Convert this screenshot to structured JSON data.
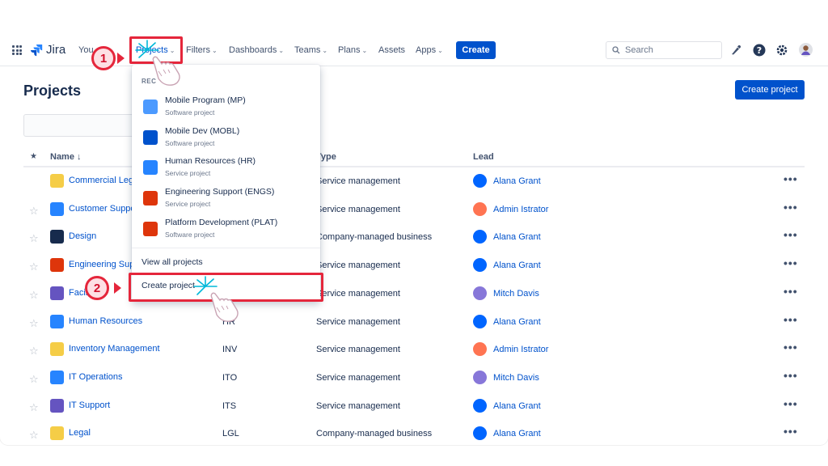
{
  "nav": {
    "logo": "Jira",
    "items": [
      {
        "label": "Your work",
        "visible": "You",
        "active": false
      },
      {
        "label": "Projects",
        "active": true
      },
      {
        "label": "Filters"
      },
      {
        "label": "Dashboards"
      },
      {
        "label": "Teams"
      },
      {
        "label": "Plans"
      },
      {
        "label": "Assets"
      },
      {
        "label": "Apps"
      }
    ],
    "create_label": "Create",
    "search_placeholder": "Search"
  },
  "page": {
    "title": "Projects",
    "create_project_label": "Create project"
  },
  "table": {
    "headers": {
      "name": "Name ↓",
      "type": "Type",
      "lead": "Lead"
    },
    "rows": [
      {
        "name": "Commercial Legal",
        "visible_name": "Commercial Lega",
        "key": "",
        "type": "Service management",
        "lead": "Alana Grant",
        "icon_color": "#f5cd47",
        "avatar_color": "#0065ff",
        "starred": true
      },
      {
        "name": "Customer Support",
        "visible_name": "Customer Suppo",
        "key": "",
        "type": "Service management",
        "lead": "Admin Istrator",
        "icon_color": "#2684ff",
        "avatar_color": "#ff7452",
        "starred": false
      },
      {
        "name": "Design",
        "visible_name": "Design",
        "key": "",
        "type": "Company-managed business",
        "lead": "Alana Grant",
        "icon_color": "#172b4d",
        "avatar_color": "#0065ff",
        "starred": false
      },
      {
        "name": "Engineering Support",
        "visible_name": "Engineering Supp",
        "key": "",
        "type": "Service management",
        "lead": "Alana Grant",
        "icon_color": "#de350b",
        "avatar_color": "#0065ff",
        "starred": false
      },
      {
        "name": "Facilities",
        "visible_name": "Facil",
        "key": "",
        "type": "Service management",
        "lead": "Mitch Davis",
        "icon_color": "#6554c0",
        "avatar_color": "#8777d9",
        "starred": false
      },
      {
        "name": "Human Resources",
        "visible_name": "Human Resources",
        "key": "HR",
        "type": "Service management",
        "lead": "Alana Grant",
        "icon_color": "#2684ff",
        "avatar_color": "#0065ff",
        "starred": false
      },
      {
        "name": "Inventory Management",
        "visible_name": "Inventory Management",
        "key": "INV",
        "type": "Service management",
        "lead": "Admin Istrator",
        "icon_color": "#f5cd47",
        "avatar_color": "#ff7452",
        "starred": false
      },
      {
        "name": "IT Operations",
        "visible_name": "IT Operations",
        "key": "ITO",
        "type": "Service management",
        "lead": "Mitch Davis",
        "icon_color": "#2684ff",
        "avatar_color": "#8777d9",
        "starred": false
      },
      {
        "name": "IT Support",
        "visible_name": "IT Support",
        "key": "ITS",
        "type": "Service management",
        "lead": "Alana Grant",
        "icon_color": "#6554c0",
        "avatar_color": "#0065ff",
        "starred": false
      },
      {
        "name": "Legal",
        "visible_name": "Legal",
        "key": "LGL",
        "type": "Company-managed business",
        "lead": "Alana Grant",
        "icon_color": "#f5cd47",
        "avatar_color": "#0065ff",
        "starred": false
      }
    ]
  },
  "dropdown": {
    "section_label": "RECENT",
    "section_visible": "REC",
    "items": [
      {
        "title": "Mobile Program (MP)",
        "subtitle": "Software project",
        "icon_color": "#4c9aff"
      },
      {
        "title": "Mobile Dev (MOBL)",
        "subtitle": "Software project",
        "icon_color": "#0052cc"
      },
      {
        "title": "Human Resources (HR)",
        "subtitle": "Service project",
        "icon_color": "#2684ff"
      },
      {
        "title": "Engineering Support (ENGS)",
        "subtitle": "Service project",
        "icon_color": "#de350b"
      },
      {
        "title": "Platform Development (PLAT)",
        "subtitle": "Software project",
        "icon_color": "#de350b"
      }
    ],
    "view_all_label": "View all projects",
    "create_label": "Create project"
  },
  "annotations": {
    "step1": "1",
    "step2": "2",
    "accent": "#e5263b"
  }
}
